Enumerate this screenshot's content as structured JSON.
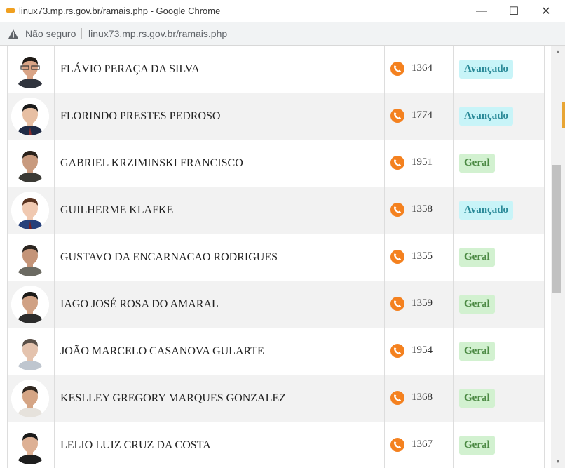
{
  "window": {
    "title": "linux73.mp.rs.gov.br/ramais.php - Google Chrome",
    "min_glyph": "—",
    "max_glyph": "☐",
    "close_glyph": "✕"
  },
  "address_bar": {
    "security_label": "Não seguro",
    "url": "linux73.mp.rs.gov.br/ramais.php"
  },
  "people": [
    {
      "name": "",
      "extension": "",
      "level": ""
    },
    {
      "name": "FLÁVIO PERAÇA DA SILVA",
      "extension": "1364",
      "level": "Avançado"
    },
    {
      "name": "FLORINDO PRESTES PEDROSO",
      "extension": "1774",
      "level": "Avançado"
    },
    {
      "name": "GABRIEL KRZIMINSKI FRANCISCO",
      "extension": "1951",
      "level": "Geral"
    },
    {
      "name": "GUILHERME KLAFKE",
      "extension": "1358",
      "level": "Avançado"
    },
    {
      "name": "GUSTAVO DA ENCARNACAO RODRIGUES",
      "extension": "1355",
      "level": "Geral"
    },
    {
      "name": "IAGO JOSÉ ROSA DO AMARAL",
      "extension": "1359",
      "level": "Geral"
    },
    {
      "name": "JOÃO MARCELO CASANOVA GULARTE",
      "extension": "1954",
      "level": "Geral"
    },
    {
      "name": "KESLLEY GREGORY MARQUES GONZALEZ",
      "extension": "1368",
      "level": "Geral"
    },
    {
      "name": "LELIO LUIZ CRUZ DA COSTA",
      "extension": "1367",
      "level": "Geral"
    }
  ],
  "colors": {
    "phone_icon": "#f4811f",
    "avancado_bg": "#c8f4f8",
    "avancado_text": "#2a8a98",
    "geral_bg": "#d2f1d0",
    "geral_text": "#4c8a44",
    "row_alt": "#f2f2f2"
  },
  "icons": {
    "favicon": "favicon-icon",
    "warning": "warning-triangle-icon",
    "phone": "phone-icon",
    "minimize": "minimize-icon",
    "maximize": "maximize-icon",
    "close": "close-icon"
  }
}
